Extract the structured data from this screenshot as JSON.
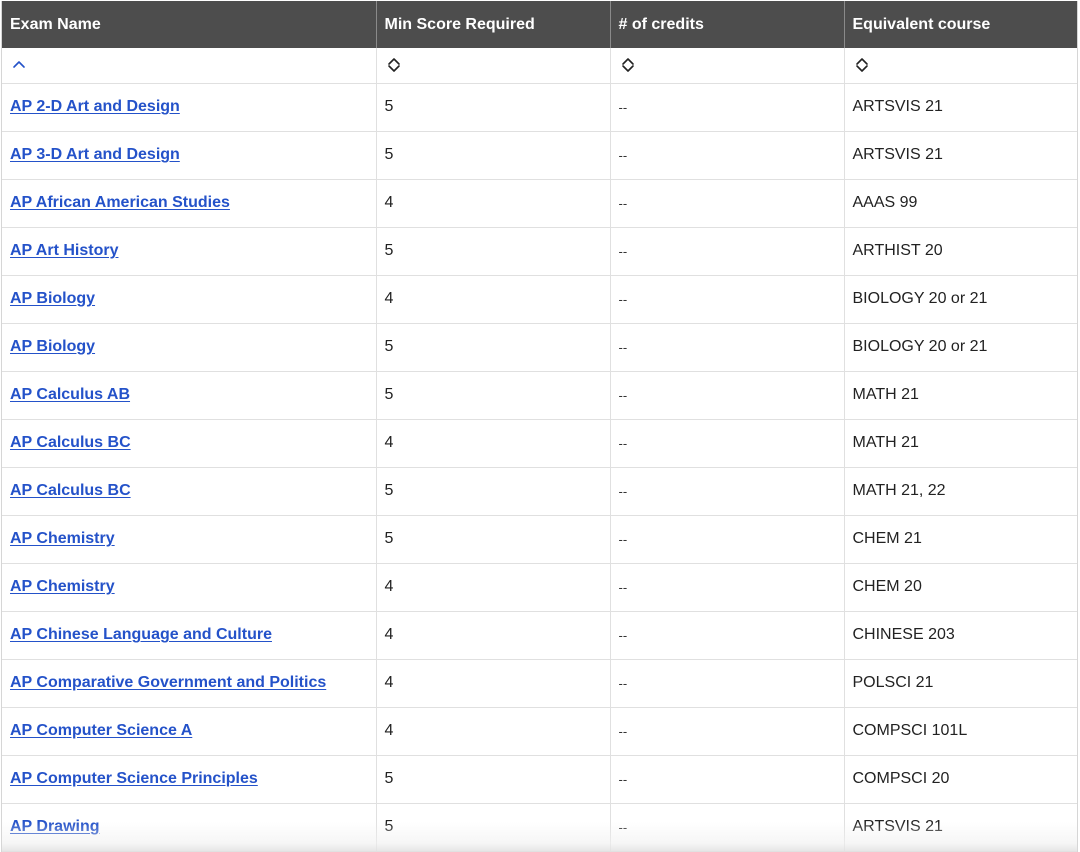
{
  "table": {
    "headers": [
      "Exam Name",
      "Min Score Required",
      "# of credits",
      "Equivalent course"
    ],
    "sort_icons": [
      "chevron-up-icon",
      "sort-both-icon",
      "sort-both-icon",
      "sort-both-icon"
    ],
    "colors": {
      "header_bg": "#4d4d4d",
      "link": "#2452c9",
      "sort_icon_active": "#2452c9"
    },
    "rows": [
      {
        "exam": "AP 2-D Art and Design",
        "min_score": "5",
        "credits": "--",
        "course": "ARTSVIS 21"
      },
      {
        "exam": "AP 3-D Art and Design",
        "min_score": "5",
        "credits": "--",
        "course": "ARTSVIS 21"
      },
      {
        "exam": "AP African American Studies",
        "min_score": "4",
        "credits": "--",
        "course": "AAAS 99"
      },
      {
        "exam": "AP Art History",
        "min_score": "5",
        "credits": "--",
        "course": "ARTHIST 20"
      },
      {
        "exam": "AP Biology",
        "min_score": "4",
        "credits": "--",
        "course": "BIOLOGY 20 or 21"
      },
      {
        "exam": "AP Biology",
        "min_score": "5",
        "credits": "--",
        "course": "BIOLOGY 20 or 21"
      },
      {
        "exam": "AP Calculus AB",
        "min_score": "5",
        "credits": "--",
        "course": "MATH 21"
      },
      {
        "exam": "AP Calculus BC",
        "min_score": "4",
        "credits": "--",
        "course": "MATH 21"
      },
      {
        "exam": "AP Calculus BC",
        "min_score": "5",
        "credits": "--",
        "course": "MATH 21, 22"
      },
      {
        "exam": "AP Chemistry",
        "min_score": "5",
        "credits": "--",
        "course": "CHEM 21"
      },
      {
        "exam": "AP Chemistry",
        "min_score": "4",
        "credits": "--",
        "course": "CHEM 20"
      },
      {
        "exam": "AP Chinese Language and Culture",
        "min_score": "4",
        "credits": "--",
        "course": "CHINESE 203"
      },
      {
        "exam": "AP Comparative Government and Politics",
        "min_score": "4",
        "credits": "--",
        "course": "POLSCI 21"
      },
      {
        "exam": "AP Computer Science A",
        "min_score": "4",
        "credits": "--",
        "course": "COMPSCI 101L"
      },
      {
        "exam": "AP Computer Science Principles",
        "min_score": "5",
        "credits": "--",
        "course": "COMPSCI 20"
      },
      {
        "exam": "AP Drawing",
        "min_score": "5",
        "credits": "--",
        "course": "ARTSVIS 21"
      }
    ]
  }
}
